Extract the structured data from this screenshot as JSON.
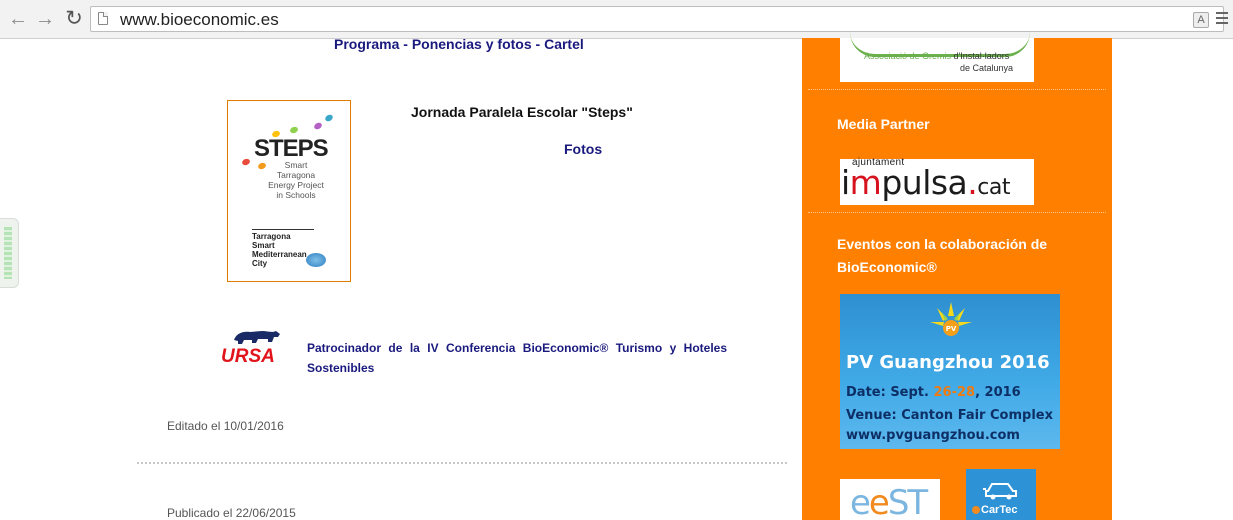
{
  "browser": {
    "url": "www.bioeconomic.es"
  },
  "main": {
    "links": {
      "programa": "Programa",
      "sep": " - ",
      "ponencias": "Ponencias y fotos",
      "cartel": "Cartel"
    },
    "steps_logo": {
      "title": "STEPS",
      "subtitle": "Smart Tarragona Energy Project in Schools",
      "city": "Tarragona Smart Mediterranean City"
    },
    "jornada_title": "Jornada Paralela Escolar \"Steps\"",
    "fotos_link": "Fotos",
    "ursa_logo_text": "URSA",
    "sponsor_text": "Patrocinador de la IV Conferencia BioEconomic® Turismo y Hoteles Sostenibles",
    "edited": "Editado el 10/01/2016",
    "published": "Publicado el 22/06/2015"
  },
  "sidebar": {
    "gremis_logo": {
      "line1_prefix": "Associació de Gremis",
      "line1_suffix": "d'Instal·ladors",
      "line2": "de Catalunya"
    },
    "media_partner_heading": "Media Partner",
    "impulsa_logo": {
      "top": "ajuntament",
      "main_a": "i",
      "main_b": "m",
      "main_c": "pulsa",
      "dot": ".",
      "tld": "cat"
    },
    "eventos_heading": "Eventos con la colaboración de BioEconomic®",
    "pv_banner": {
      "badge": "PV",
      "title": "PV Guangzhou 2016",
      "date_prefix": "Date: Sept. ",
      "date_range": "26-28",
      "date_suffix": ", 2016",
      "venue": "Venue: Canton Fair Complex",
      "url": "www.pvguangzhou.com"
    },
    "eest_logo": {
      "a": "e",
      "b": "e",
      "c": "ST"
    },
    "cartec_logo": {
      "label": "CarTec"
    }
  },
  "colors": {
    "sidebar_bg": "#ff7f00",
    "link_navy": "#1a1a7e",
    "ursa_red": "#e1131b"
  }
}
